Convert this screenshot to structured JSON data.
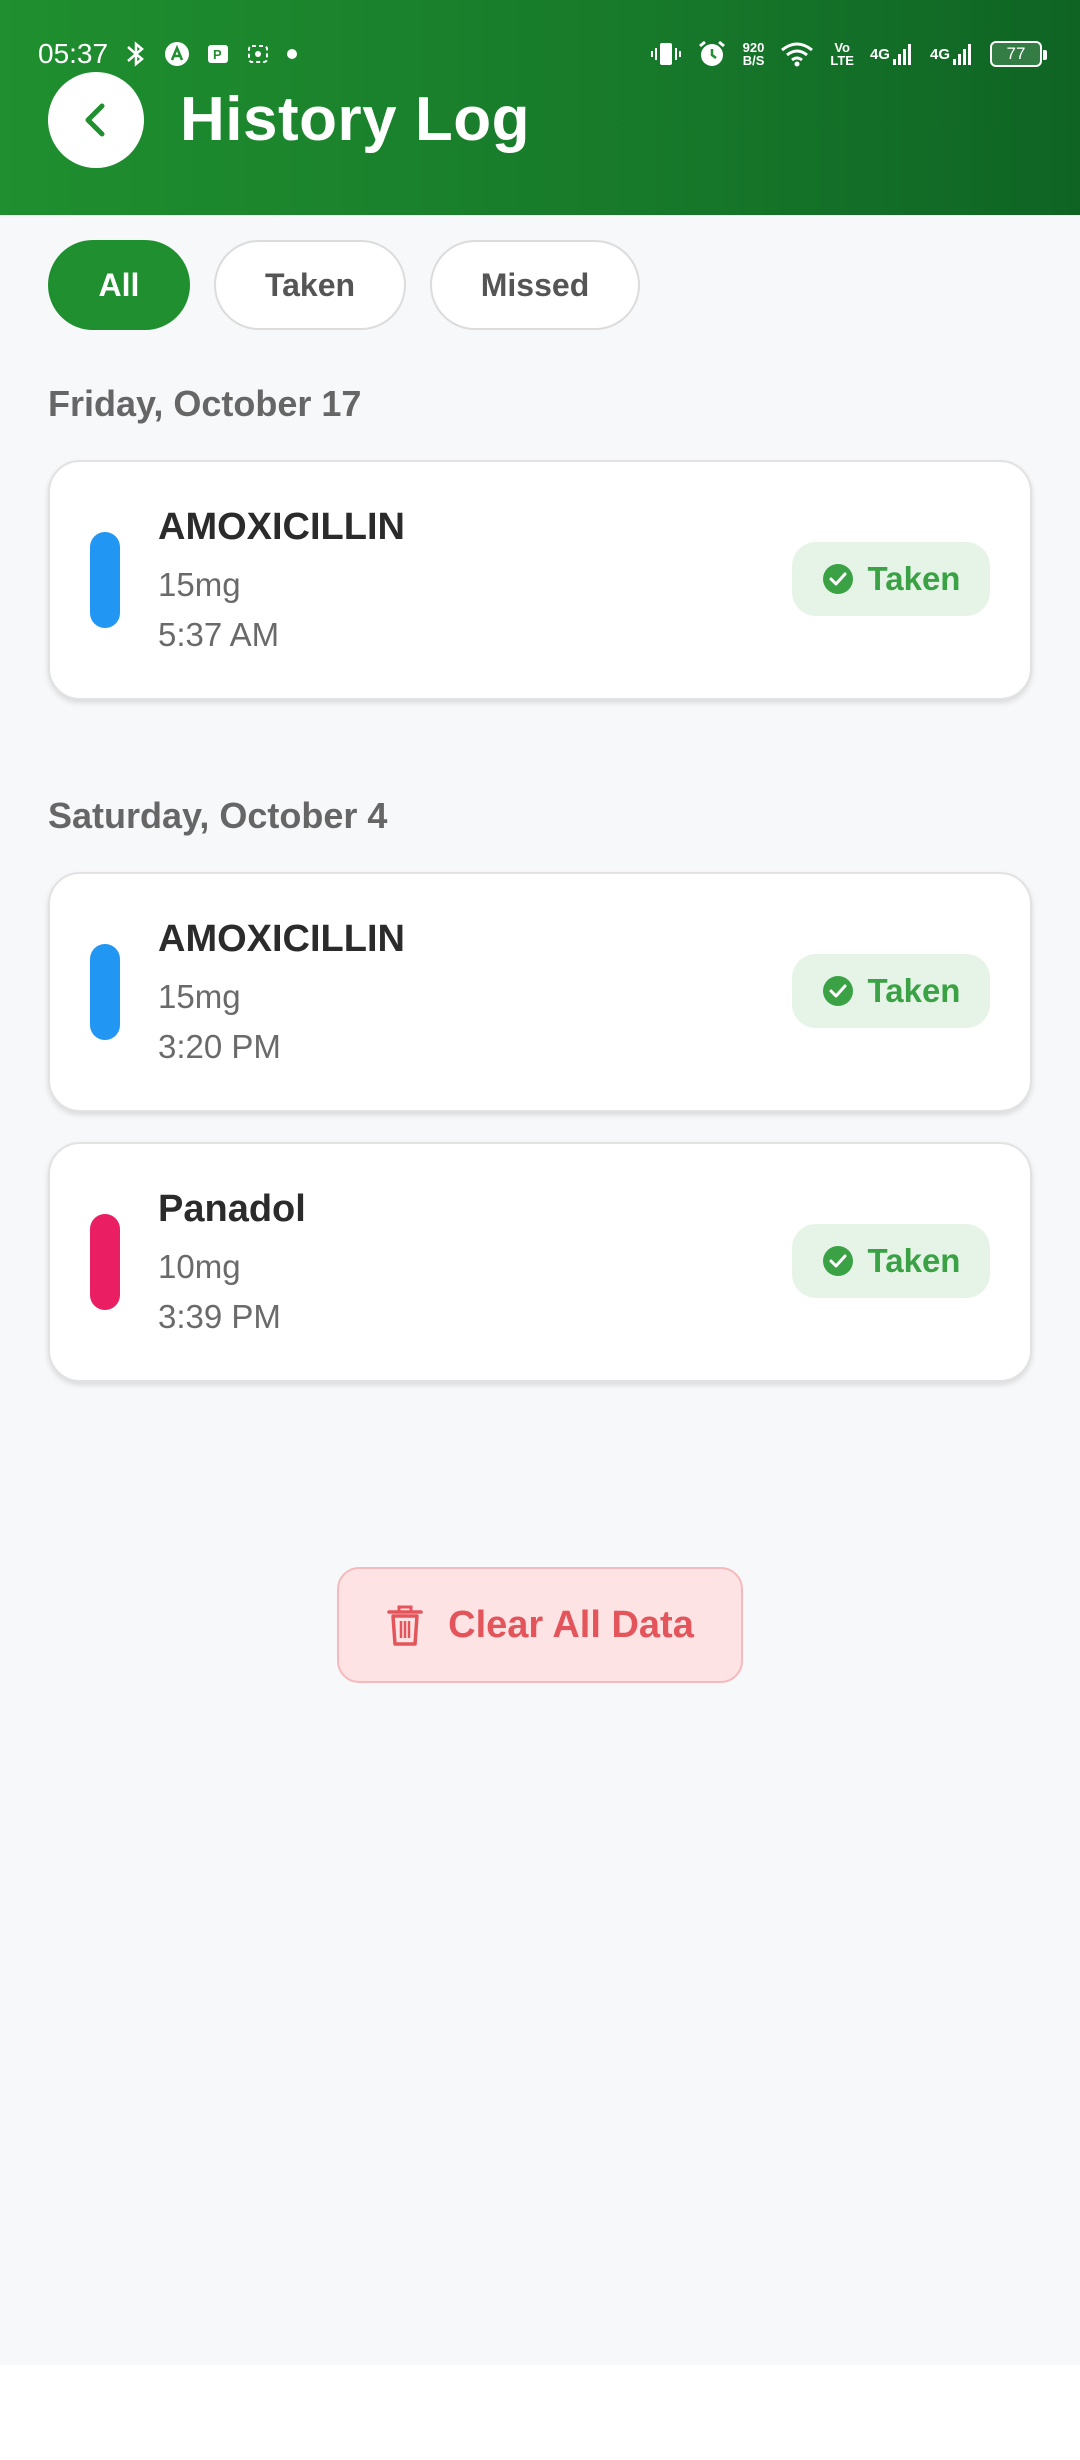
{
  "status_bar": {
    "time": "05:37",
    "net_speed_top": "920",
    "net_speed_bottom": "B/S",
    "volte_top": "Vo",
    "volte_bottom": "LTE",
    "signal1": "4G",
    "signal2": "4G",
    "battery": "77"
  },
  "header": {
    "title": "History Log",
    "back_icon": "chevron-left-icon"
  },
  "filters": [
    {
      "label": "All",
      "active": true
    },
    {
      "label": "Taken",
      "active": false
    },
    {
      "label": "Missed",
      "active": false
    }
  ],
  "sections": [
    {
      "date": "Friday, October 17",
      "entries": [
        {
          "name": "AMOXICILLIN",
          "dose": "15mg",
          "time": "5:37 AM",
          "status": "Taken",
          "color": "#2196f3"
        }
      ]
    },
    {
      "date": "Saturday, October 4",
      "entries": [
        {
          "name": "AMOXICILLIN",
          "dose": "15mg",
          "time": "3:20 PM",
          "status": "Taken",
          "color": "#2196f3"
        },
        {
          "name": "Panadol",
          "dose": "10mg",
          "time": "3:39 PM",
          "status": "Taken",
          "color": "#e91e63"
        }
      ]
    }
  ],
  "clear_button": {
    "label": "Clear All Data",
    "icon": "trash-icon"
  },
  "colors": {
    "header_green": "#1f8f2f",
    "taken_green": "#3aa244",
    "danger_red": "#e4555b"
  }
}
